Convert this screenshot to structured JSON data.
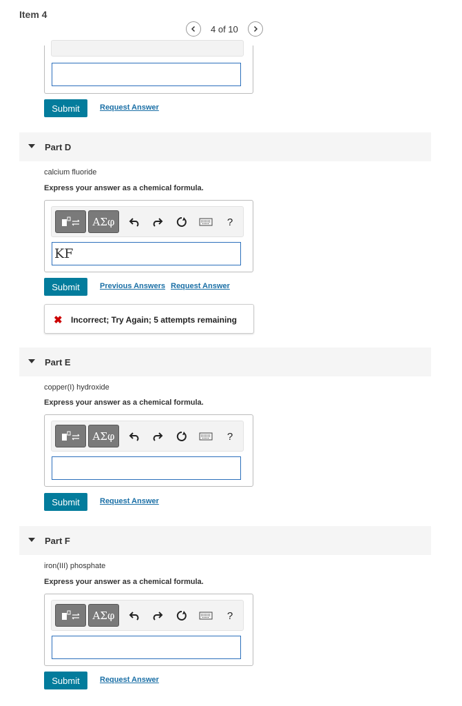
{
  "header": {
    "item_title": "Item 4",
    "pager_text": "4 of 10"
  },
  "toolbar": {
    "greek_label": "ΑΣφ",
    "help_label": "?"
  },
  "part_c": {
    "answer_value": "",
    "submit_label": "Submit",
    "request_answer_label": "Request Answer"
  },
  "part_d": {
    "label": "Part D",
    "compound": "calcium fluoride",
    "instruction": "Express your answer as a chemical formula.",
    "answer_value": "KF",
    "submit_label": "Submit",
    "previous_answers_label": "Previous Answers",
    "request_answer_label": "Request Answer",
    "feedback": "Incorrect; Try Again; 5 attempts remaining"
  },
  "part_e": {
    "label": "Part E",
    "compound": "copper(I) hydroxide",
    "instruction": "Express your answer as a chemical formula.",
    "answer_value": "",
    "submit_label": "Submit",
    "request_answer_label": "Request Answer"
  },
  "part_f": {
    "label": "Part F",
    "compound": "iron(III) phosphate",
    "instruction": "Express your answer as a chemical formula.",
    "answer_value": "",
    "submit_label": "Submit",
    "request_answer_label": "Request Answer"
  },
  "colors": {
    "submit_bg": "#037c9c",
    "link": "#1a6fa6",
    "error": "#cc0000",
    "input_border": "#2a6ebb"
  }
}
